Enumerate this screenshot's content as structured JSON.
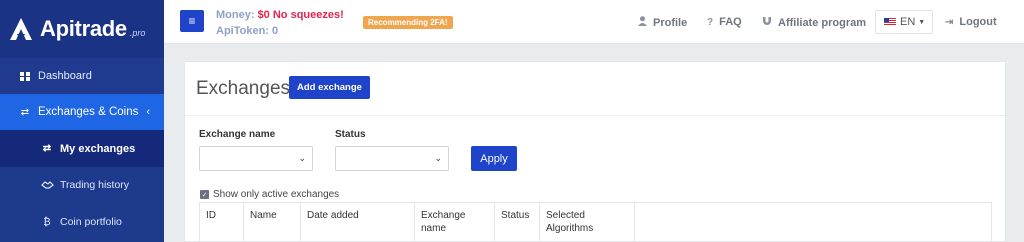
{
  "brand": {
    "name": "Apitrade",
    "suffix": ".pro"
  },
  "sidebar": {
    "items": [
      {
        "label": "Dashboard",
        "icon": "dashboard-icon"
      },
      {
        "label": "Exchanges & Coins",
        "icon": "exchange-arrows-icon"
      },
      {
        "label": "My exchanges",
        "icon": "exchange-arrows-icon"
      },
      {
        "label": "Trading history",
        "icon": "handshake-icon"
      },
      {
        "label": "Coin portfolio",
        "icon": "bitcoin-icon"
      }
    ]
  },
  "topbar": {
    "money_label": "Money:",
    "money_value": "$0 No squeezes!",
    "apitoken_label": "ApiToken:",
    "apitoken_value": "0",
    "badge": "Recommending 2FA!",
    "links": {
      "profile": "Profile",
      "faq": "FAQ",
      "affiliate": "Affiliate program",
      "logout": "Logout"
    },
    "language": "EN"
  },
  "main": {
    "title": "Exchanges",
    "add_button": "Add exchange",
    "filters": {
      "exchange_name_label": "Exchange name",
      "status_label": "Status",
      "apply_button": "Apply"
    },
    "show_active_label": "Show only active exchanges",
    "show_active_checked": true,
    "table_columns": [
      "ID",
      "Name",
      "Date added",
      "Exchange name",
      "Status",
      "Selected Algorithms"
    ]
  },
  "colors": {
    "sidebar": "#1f3a8f",
    "active": "#1f66e5",
    "primary": "#1f44c9",
    "warning": "#f0a64e",
    "money": "#e02450"
  }
}
